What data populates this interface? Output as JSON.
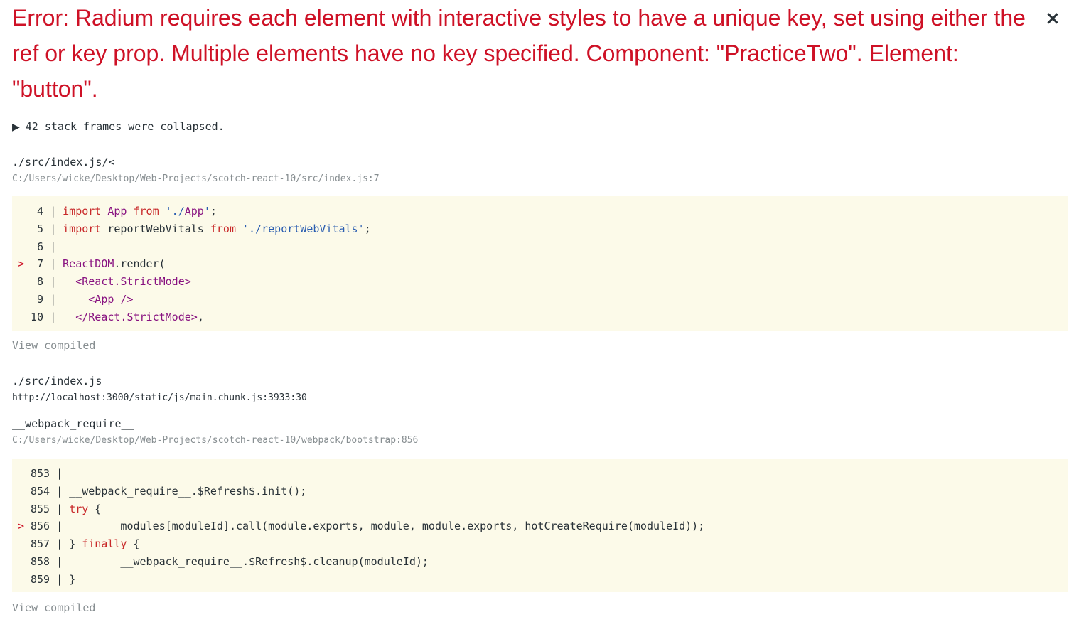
{
  "error": {
    "title": "Error: Radium requires each element with interactive styles to have a unique key, set using either the ref or key prop. Multiple elements have no key specified. Component: \"PracticeTwo\". Element: \"button\".",
    "close_glyph": "×"
  },
  "collapsed_frames": {
    "icon": "triangle-right-icon",
    "glyph": "▶",
    "label": "42 stack frames were collapsed."
  },
  "frames": [
    {
      "function": "./src/index.js/<",
      "location": "C:/Users/wicke/Desktop/Web-Projects/scotch-react-10/src/index.js:7",
      "code": [
        {
          "marker": "",
          "num": "4",
          "text": " | import App from './App';"
        },
        {
          "marker": "",
          "num": "5",
          "text": " | import reportWebVitals from './reportWebVitals';"
        },
        {
          "marker": "",
          "num": "6",
          "text": " |"
        },
        {
          "marker": ">",
          "num": "7",
          "text": " | ReactDOM.render("
        },
        {
          "marker": "",
          "num": "8",
          "text": " |   <React.StrictMode>"
        },
        {
          "marker": "",
          "num": "9",
          "text": " |     <App />"
        },
        {
          "marker": "",
          "num": "10",
          "text": " |   </React.StrictMode>,"
        }
      ],
      "view_compiled": "View compiled"
    },
    {
      "function": "./src/index.js",
      "location": "http://localhost:3000/static/js/main.chunk.js:3933:30"
    },
    {
      "function": "__webpack_require__",
      "location": "C:/Users/wicke/Desktop/Web-Projects/scotch-react-10/webpack/bootstrap:856",
      "code": [
        {
          "marker": "",
          "num": "853",
          "text": " |"
        },
        {
          "marker": "",
          "num": "854",
          "text": " | __webpack_require__.$Refresh$.init();"
        },
        {
          "marker": "",
          "num": "855",
          "text": " | try {"
        },
        {
          "marker": ">",
          "num": "856",
          "text": " |         modules[moduleId].call(module.exports, module, module.exports, hotCreateRequire(moduleId));"
        },
        {
          "marker": "",
          "num": "857",
          "text": " | } finally {"
        },
        {
          "marker": "",
          "num": "858",
          "text": " |         __webpack_require__.$Refresh$.cleanup(moduleId);"
        },
        {
          "marker": "",
          "num": "859",
          "text": " | }"
        }
      ],
      "view_compiled": "View compiled"
    }
  ]
}
